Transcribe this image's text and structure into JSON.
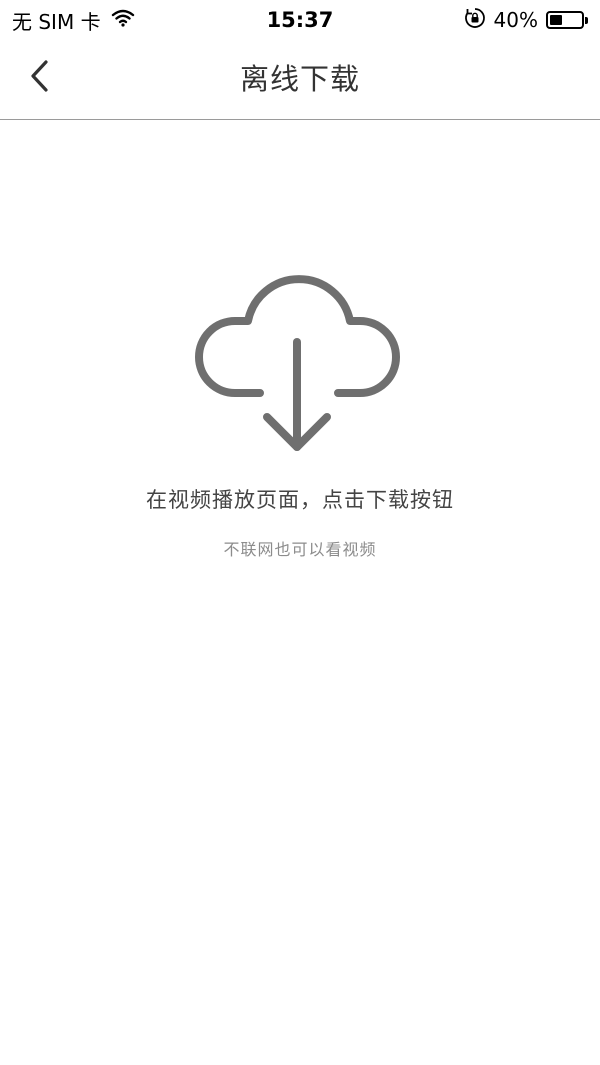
{
  "status_bar": {
    "carrier": "无 SIM 卡",
    "time": "15:37",
    "battery_percent": "40%",
    "battery_level": 0.4,
    "icons": [
      "wifi-icon",
      "orientation-lock-icon",
      "battery-icon"
    ]
  },
  "nav": {
    "title": "离线下载",
    "back_icon": "chevron-left-icon"
  },
  "empty_state": {
    "icon": "cloud-download-icon",
    "title": "在视频播放页面，点击下载按钮",
    "subtitle": "不联网也可以看视频"
  },
  "colors": {
    "icon": "#6f6f6f",
    "title_text": "#444444",
    "subtitle_text": "#8c8c8c",
    "divider": "#9a9a9a",
    "background": "#ffffff"
  }
}
